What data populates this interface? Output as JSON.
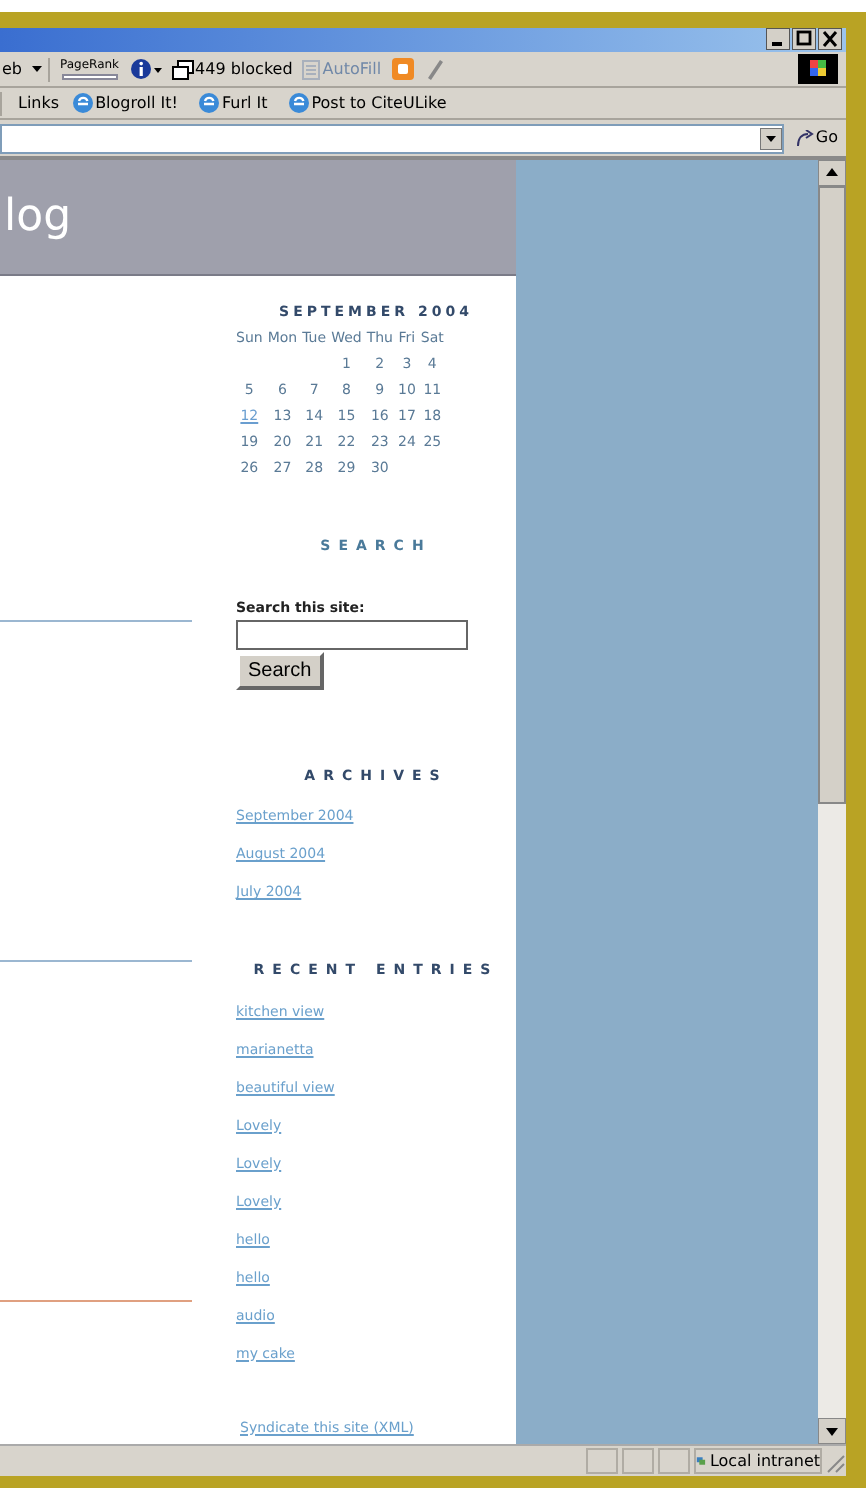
{
  "toolbar": {
    "items": [
      {
        "kind": "dropdown",
        "label": "eb"
      },
      {
        "kind": "pagerank",
        "label": "PageRank"
      },
      {
        "kind": "info"
      },
      {
        "kind": "popup",
        "label": "449 blocked"
      },
      {
        "kind": "autofill",
        "label": "AutoFill",
        "disabled": true
      },
      {
        "kind": "blogger"
      },
      {
        "kind": "pencil"
      }
    ]
  },
  "links_bar": {
    "label": "Links",
    "links": [
      "Blogroll It!",
      "Furl It",
      "Post to CiteULike"
    ]
  },
  "address_bar": {
    "go": "Go"
  },
  "blog": {
    "title": "log"
  },
  "calendar": {
    "title": "SEPTEMBER 2004",
    "weekdays": [
      "Sun",
      "Mon",
      "Tue",
      "Wed",
      "Thu",
      "Fri",
      "Sat"
    ],
    "weeks": [
      [
        {
          "day": "1",
          "linked": false
        },
        {
          "day": "2",
          "linked": false
        },
        {
          "day": "3",
          "linked": false
        },
        {
          "day": "4",
          "linked": false
        }
      ],
      [
        {
          "day": "5",
          "linked": false
        },
        {
          "day": "6",
          "linked": false
        },
        {
          "day": "7",
          "linked": false
        },
        {
          "day": "8",
          "linked": false
        },
        {
          "day": "9",
          "linked": false
        },
        {
          "day": "10",
          "linked": false
        },
        {
          "day": "11",
          "linked": false
        }
      ],
      [
        {
          "day": "12",
          "linked": true
        },
        {
          "day": "13",
          "linked": false
        },
        {
          "day": "14",
          "linked": false
        },
        {
          "day": "15",
          "linked": false
        },
        {
          "day": "16",
          "linked": false
        },
        {
          "day": "17",
          "linked": false
        },
        {
          "day": "18",
          "linked": false
        }
      ],
      [
        {
          "day": "19",
          "linked": false
        },
        {
          "day": "20",
          "linked": false
        },
        {
          "day": "21",
          "linked": false
        },
        {
          "day": "22",
          "linked": false
        },
        {
          "day": "23",
          "linked": false
        },
        {
          "day": "24",
          "linked": false
        },
        {
          "day": "25",
          "linked": false
        }
      ],
      [
        {
          "day": "26",
          "linked": false
        },
        {
          "day": "27",
          "linked": false
        },
        {
          "day": "28",
          "linked": false
        },
        {
          "day": "29",
          "linked": false
        },
        {
          "day": "30",
          "linked": false
        }
      ]
    ]
  },
  "search": {
    "heading": "SEARCH",
    "label": "Search this site:",
    "button": "Search"
  },
  "archives": {
    "heading": "ARCHIVES",
    "links": [
      "September 2004",
      "August 2004",
      "July 2004"
    ]
  },
  "recent_entries": {
    "heading": "RECENT ENTRIES",
    "links": [
      "kitchen view",
      "marianetta",
      "beautiful view",
      "Lovely",
      "Lovely",
      "Lovely",
      "hello",
      "hello",
      "audio",
      "my cake"
    ]
  },
  "syndicate": "Syndicate this site (XML)",
  "status_bar": {
    "zone": "Local intranet"
  }
}
